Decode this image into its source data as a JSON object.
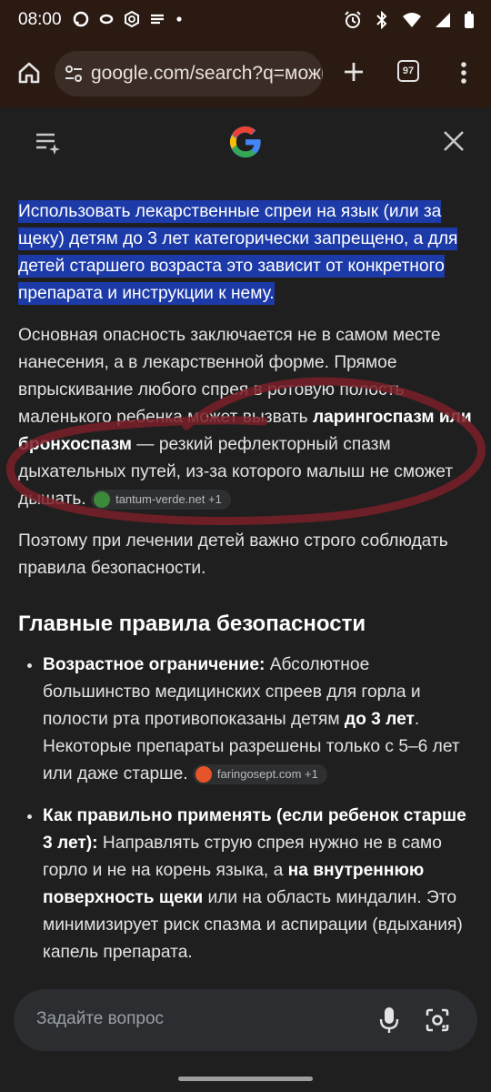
{
  "status": {
    "time": "08:00"
  },
  "browser": {
    "url": "google.com/search?q=можно",
    "tab_count": "97"
  },
  "content": {
    "highlight": "Использовать лекарственные спреи на язык (или за щеку) детям до 3 лет категорически запрещено, а для детей старшего возраста это зависит от конкретного препарата и инструкции к нему.",
    "p1_a": "Основная опасность заключается не в самом месте нанесения, а в лекарственной форме. Прямое впрыскивание любого спрея в ротовую полость маленького ребенка может вызвать ",
    "p1_b": "ларингоспазм или бронхоспазм",
    "p1_c": " — резкий рефлекторный спазм дыхательных путей, из-за которого малыш не сможет дышать.",
    "chip1": "tantum-verde.net +1",
    "p2": "Поэтому при лечении детей важно строго соблюдать правила безопасности.",
    "heading": "Главные правила безопасности",
    "b1_title": "Возрастное ограничение:",
    "b1_a": " Абсолютное большинство медицинских спреев для горла и полости рта противопоказаны детям ",
    "b1_b": "до 3 лет",
    "b1_c": ". Некоторые препараты разрешены только с 5–6 лет или даже старше.",
    "chip2": "faringosept.com +1",
    "b2_title": "Как правильно применять (если ребенок старше 3 лет):",
    "b2_a": " Направлять струю спрея нужно не в само горло и не на корень языка, а ",
    "b2_b": "на внутреннюю поверхность щеки",
    "b2_c": " или на область миндалин. Это минимизирует риск спазма и аспирации (вдыхания) капель препарата."
  },
  "ask": {
    "placeholder": "Задайте вопрос"
  },
  "colors": {
    "highlight": "#1c3aa8",
    "scribble": "#7a2028",
    "toolbar": "#2a1a12"
  }
}
